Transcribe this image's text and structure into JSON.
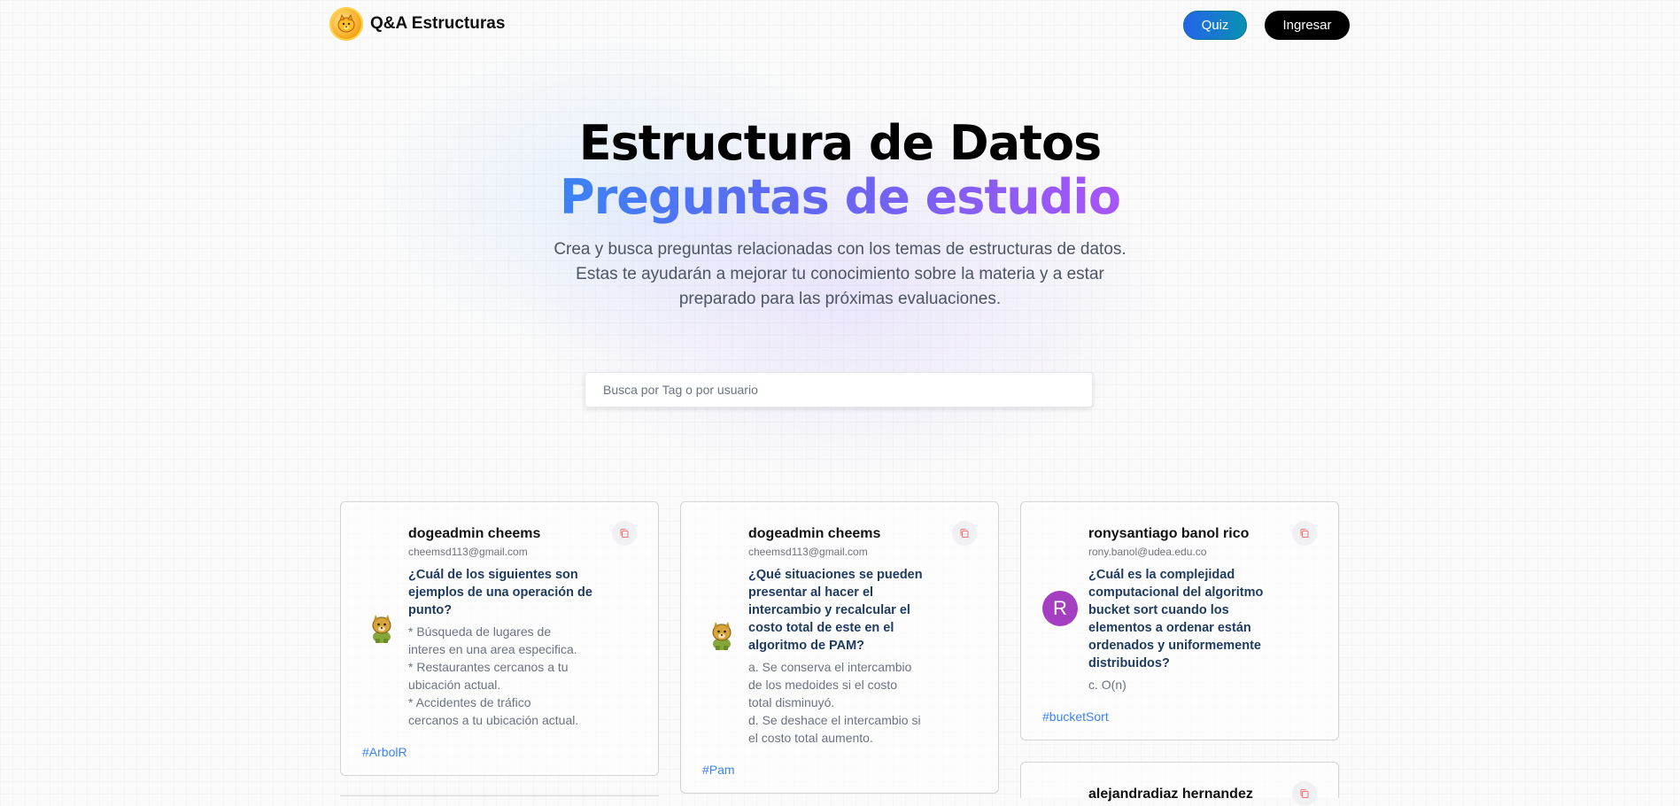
{
  "brand": {
    "name": "Q&A Estructuras",
    "logo_icon": "doge-logo-icon"
  },
  "nav": {
    "quiz_label": "Quiz",
    "login_label": "Ingresar"
  },
  "hero": {
    "title": "Estructura de Datos",
    "subtitle": "Preguntas de estudio",
    "description_lines": [
      "Crea y busca preguntas relacionadas con los temas de estructuras de datos.",
      "Estas te ayudarán a mejorar tu conocimiento sobre la materia y a estar",
      "preparado para las próximas evaluaciones."
    ]
  },
  "search": {
    "placeholder": "Busca por Tag o por usuario",
    "value": ""
  },
  "cards": [
    {
      "name": "dogeadmin cheems",
      "email": "cheemsd113@gmail.com",
      "avatar": "doge-avatar-icon",
      "question_lines": [
        "¿Cuál de los siguientes son",
        "ejemplos de una operación de",
        "punto?"
      ],
      "answer_lines": [
        "* Búsqueda de lugares de",
        "interes en una area especifica.",
        "* Restaurantes cercanos a tu",
        "ubicación actual.",
        "* Accidentes de tráfico",
        "cercanos a tu ubicación actual."
      ],
      "tag": "#ArbolR"
    },
    {
      "name": "dogeadmin cheems",
      "email": "cheemsd113@gmail.com",
      "avatar": "doge-avatar-icon",
      "question_lines": [
        "¿Qué situaciones se pueden",
        "presentar al hacer el",
        "intercambio y recalcular el",
        "costo total de este en el",
        "algoritmo de PAM?"
      ],
      "answer_lines": [
        "a. Se conserva el intercambio",
        "de los medoides si el costo",
        "total disminuyó.",
        "d. Se deshace el intercambio si",
        "el costo total aumento."
      ],
      "tag": "#Pam"
    },
    {
      "name": "ronysantiago banol rico",
      "email": "rony.banol@udea.edu.co",
      "avatar_letter": "R",
      "question_lines": [
        "¿Cuál es la complejidad",
        "computacional del algoritmo",
        "bucket sort cuando los",
        "elementos a ordenar están",
        "ordenados y uniformemente",
        "distribuidos?"
      ],
      "answer_lines": [
        "c. O(n)"
      ],
      "tag": "#bucketSort"
    },
    {
      "name": "alejandradiaz hernandez"
    }
  ],
  "colors": {
    "accent_blue": "#3b82f6",
    "accent_purple": "#a855f7",
    "avatar_purple": "#a33fc0",
    "question_text": "#1e3a5f"
  }
}
